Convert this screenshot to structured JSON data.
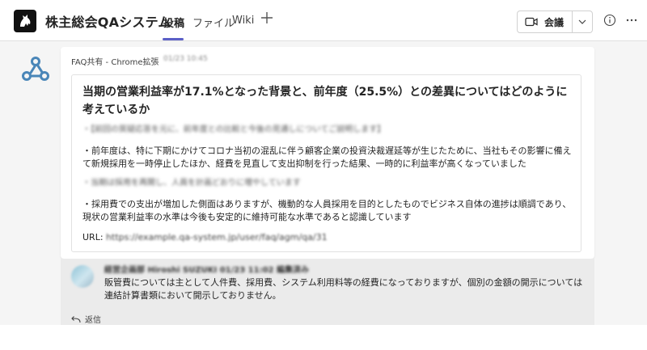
{
  "header": {
    "app_title": "株主総会QAシステム",
    "tabs": [
      {
        "label": "投稿",
        "active": true
      },
      {
        "label": "ファイル",
        "active": false
      },
      {
        "label": "Wiki",
        "active": false
      }
    ],
    "add_tab_icon": "plus-icon",
    "meet_button_label": "会議",
    "icons": [
      "video-camera-icon",
      "chevron-down-icon",
      "info-icon",
      "more-icon"
    ]
  },
  "post": {
    "sender": "FAQ共有 - Chrome拡張",
    "timestamp": "01/23 10:45",
    "question": "当期の営業利益率が17.1%となった背景と、前年度（25.5%）との差異についてはどのように考えているか",
    "answer_blurred_1": "・【前回の質疑応答を元に、前年度との比較と今後の見通しについてご説明します】",
    "answer_para_1": "・前年度は、特に下期にかけてコロナ当初の混乱に伴う顧客企業の投資決裁遅延等が生じたために、当社もその影響に備えて新規採用を一時停止したほか、経費を見直して支出抑制を行った結果、一時的に利益率が高くなっていました",
    "answer_blurred_2": "・当期は採用を再開し、人員を計画どおりに増やしています",
    "answer_para_2": "・採用費での支出が増加した側面はありますが、機動的な人員採用を目的としたものでビジネス自体の進捗は順調であり、現状の営業利益率の水準は今後も安定的に維持可能な水準であると認識しています",
    "url_label": "URL:",
    "url_value": "https://example.qa-system.jp/user/faq/agm/qa/31"
  },
  "reply": {
    "author_blurred": "経営企画部 Hiroshi SUZUKI 01/23 11:02 編集済み",
    "text": "販管費については主として人件費、採用費、システム利用料等の経費になっておりますが、個別の金額の開示については連結計算書類において開示しておりません。",
    "reply_action_label": "返信"
  },
  "colors": {
    "accent": "#5b5fc7",
    "bot_icon": "#4a86b8"
  }
}
